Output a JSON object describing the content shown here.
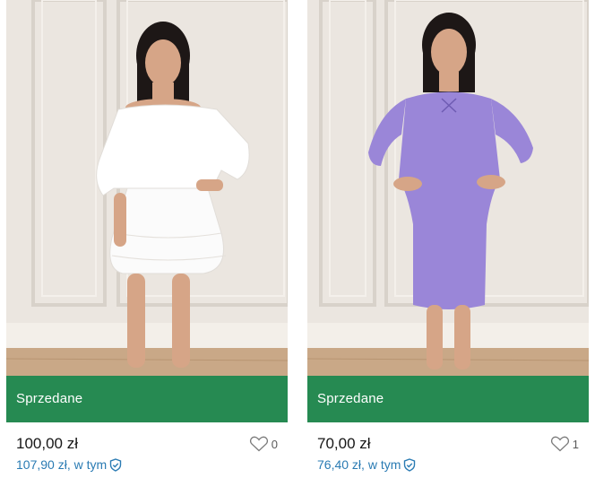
{
  "listings": [
    {
      "status_label": "Sprzedane",
      "price": "100,00 zł",
      "price_with_protection": "107,90 zł, w tym",
      "favorites": "0",
      "photo_icon": "white-off-shoulder-dress-photo",
      "colors": {
        "garment": "#ffffff",
        "accent": "#268a52"
      }
    },
    {
      "status_label": "Sprzedane",
      "price": "70,00 zł",
      "price_with_protection": "76,40 zł, w tym",
      "favorites": "1",
      "photo_icon": "lilac-knit-dress-photo",
      "colors": {
        "garment": "#9a86d8",
        "accent": "#268a52"
      }
    }
  ],
  "icons": {
    "favorite": "heart-icon",
    "protection": "shield-icon"
  }
}
